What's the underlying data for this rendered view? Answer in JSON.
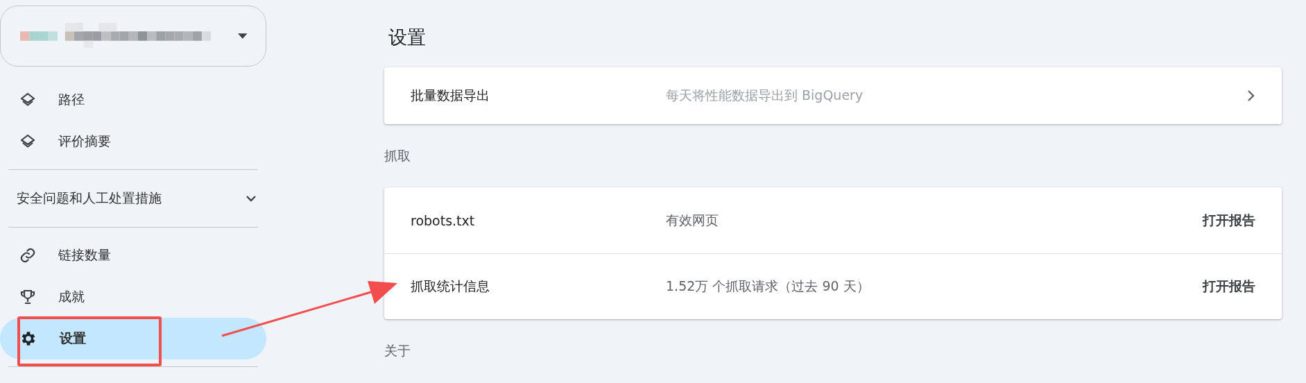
{
  "property_selector": {
    "expanded": false
  },
  "sidebar": {
    "items": [
      {
        "kind": "link",
        "label": "路径",
        "selected": false
      },
      {
        "kind": "link",
        "label": "评价摘要",
        "selected": false
      },
      {
        "kind": "divider"
      },
      {
        "kind": "section",
        "label": "安全问题和人工处置措施",
        "expanded": false
      },
      {
        "kind": "divider"
      },
      {
        "kind": "link",
        "label": "链接数量",
        "selected": false
      },
      {
        "kind": "link",
        "label": "成就",
        "selected": false
      },
      {
        "kind": "link",
        "label": "设置",
        "selected": true
      },
      {
        "kind": "divider"
      }
    ]
  },
  "page_title": "设置",
  "sections": [
    {
      "rows": [
        {
          "name": "批量数据导出",
          "value": "每天将性能数据导出到 BigQuery",
          "value_muted": true,
          "action": {
            "kind": "chevron"
          }
        }
      ]
    },
    {
      "heading": "抓取",
      "rows": [
        {
          "name": "robots.txt",
          "value": "有效网页",
          "value_muted": false,
          "action": {
            "kind": "text",
            "label": "打开报告"
          }
        },
        {
          "name": "抓取统计信息",
          "value": "1.52万 个抓取请求（过去 90 天）",
          "value_muted": false,
          "action": {
            "kind": "text",
            "label": "打开报告"
          }
        }
      ]
    },
    {
      "heading": "关于"
    }
  ],
  "annotation": {
    "highlight": true,
    "arrow": true
  }
}
